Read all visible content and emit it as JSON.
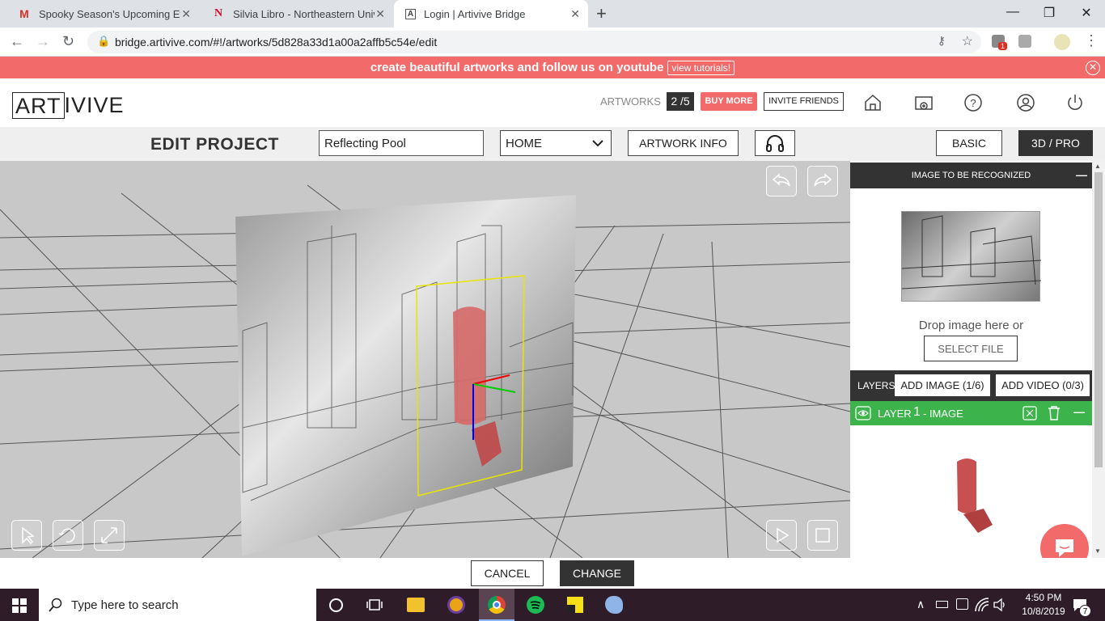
{
  "browser": {
    "tabs": [
      {
        "title": "Spooky Season's Upcoming Even",
        "favicon": "M"
      },
      {
        "title": "Silvia Libro - Northeastern Univer",
        "favicon": "N"
      },
      {
        "title": "Login | Artivive Bridge",
        "favicon": "A"
      }
    ],
    "url": "bridge.artivive.com/#!/artworks/5d828a33d1a00a2affb5c54e/edit",
    "new_tab": "+",
    "ext_badge": "1"
  },
  "banner": {
    "text": "create beautiful artworks and follow us on youtube",
    "link": "view tutorials!"
  },
  "header": {
    "logo_boxed": "ART",
    "logo_rest": "IVIVE",
    "artworks_label": "ARTWORKS",
    "artworks_count": "2 /5",
    "buy_more": "BUY MORE",
    "invite": "INVITE FRIENDS"
  },
  "edit": {
    "title": "EDIT PROJECT",
    "project_name": "Reflecting Pool",
    "category": "HOME",
    "artwork_info": "ARTWORK INFO",
    "basic": "BASIC",
    "pro": "3D / PRO"
  },
  "side": {
    "recognize_title": "IMAGE TO BE RECOGNIZED",
    "drop_text": "Drop image here or",
    "select_file": "SELECT FILE",
    "layers_label": "LAYERS",
    "add_image": "ADD IMAGE (1/6)",
    "add_video": "ADD VIDEO (0/3)",
    "layer_label": "LAYER",
    "layer_num": "1",
    "layer_type": "- IMAGE"
  },
  "bottom": {
    "cancel": "CANCEL",
    "change": "CHANGE"
  },
  "taskbar": {
    "search": "Type here to search",
    "time": "4:50 PM",
    "date": "10/8/2019",
    "notif": "7"
  },
  "colors": {
    "banner": "#f26a6a",
    "buy_more": "#f26a6a",
    "layer_green": "#3cb44b",
    "dark": "#333333"
  }
}
